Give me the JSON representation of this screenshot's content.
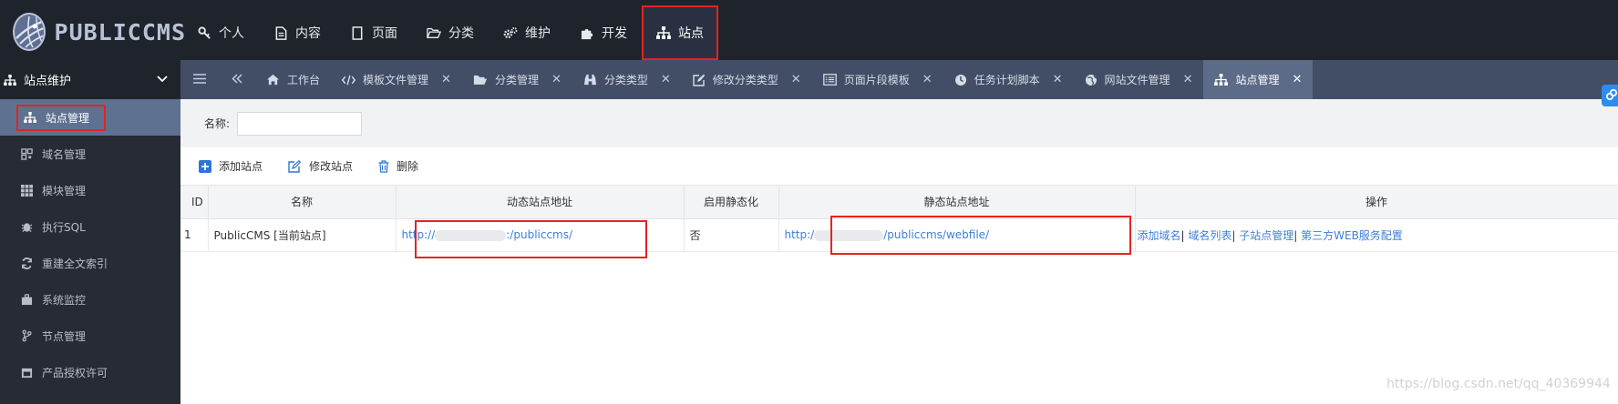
{
  "brand": {
    "name": "PUBLICCMS"
  },
  "topnav": [
    {
      "label": "个人",
      "icon": "key-icon"
    },
    {
      "label": "内容",
      "icon": "file-icon"
    },
    {
      "label": "页面",
      "icon": "page-icon"
    },
    {
      "label": "分类",
      "icon": "folder-open-icon"
    },
    {
      "label": "维护",
      "icon": "cogs-icon"
    },
    {
      "label": "开发",
      "icon": "puzzle-icon"
    },
    {
      "label": "站点",
      "icon": "sitemap-icon"
    }
  ],
  "sidebar": {
    "heading": "站点维护",
    "items": [
      {
        "label": "站点管理"
      },
      {
        "label": "域名管理"
      },
      {
        "label": "模块管理"
      },
      {
        "label": "执行SQL"
      },
      {
        "label": "重建全文索引"
      },
      {
        "label": "系统监控"
      },
      {
        "label": "节点管理"
      },
      {
        "label": "产品授权许可"
      }
    ]
  },
  "tabs": [
    {
      "label": "工作台"
    },
    {
      "label": "模板文件管理"
    },
    {
      "label": "分类管理"
    },
    {
      "label": "分类类型"
    },
    {
      "label": "修改分类类型"
    },
    {
      "label": "页面片段模板"
    },
    {
      "label": "任务计划脚本"
    },
    {
      "label": "网站文件管理"
    },
    {
      "label": "站点管理"
    }
  ],
  "filter": {
    "label": "名称:",
    "value": ""
  },
  "toolbar": {
    "add": "添加站点",
    "edit": "修改站点",
    "delete": "删除"
  },
  "table": {
    "headers": [
      "ID",
      "名称",
      "动态站点地址",
      "启用静态化",
      "静态站点地址",
      "操作"
    ],
    "row": {
      "id": "1",
      "name": "PublicCMS [当前站点]",
      "dynamic_prefix": "http://",
      "dynamic_suffix": ":/publiccms/",
      "static_flag": "否",
      "static_prefix": "http:/",
      "static_suffix": "/publiccms/webfile/",
      "actions": [
        "添加域名",
        "域名列表",
        "子站点管理",
        "第三方WEB服务配置"
      ]
    }
  },
  "watermark": "https://blog.csdn.net/qq_40369944",
  "colors": {
    "topbar": "#1f232b",
    "sidebar": "#272b34",
    "tabbar": "#424e66",
    "active": "#5f7191",
    "highlight": "#e42323",
    "link": "#3d7fd9"
  }
}
